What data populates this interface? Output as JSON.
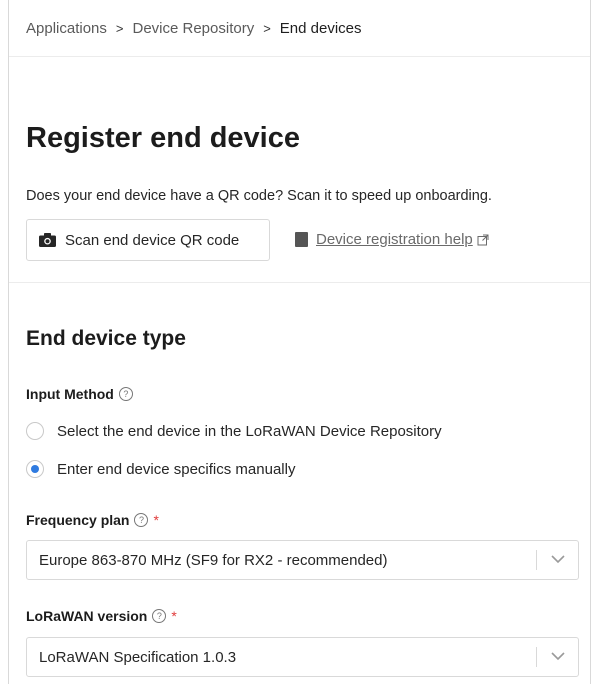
{
  "breadcrumb": {
    "items": [
      "Applications",
      "Device Repository",
      "End devices"
    ],
    "separator": ">"
  },
  "page": {
    "title": "Register end device",
    "subtitle": "Does your end device have a QR code? Scan it to speed up onboarding."
  },
  "actions": {
    "scan_label": "Scan end device QR code",
    "help_label": "Device registration help"
  },
  "section": {
    "title": "End device type"
  },
  "input_method": {
    "label": "Input Method",
    "options": [
      "Select the end device in the LoRaWAN Device Repository",
      "Enter end device specifics manually"
    ],
    "selected_index": 1
  },
  "frequency_plan": {
    "label": "Frequency plan",
    "required_mark": "*",
    "value": "Europe 863-870 MHz (SF9 for RX2 - recommended)"
  },
  "lorawan_version": {
    "label": "LoRaWAN version",
    "required_mark": "*",
    "value": "LoRaWAN Specification 1.0.3"
  },
  "colors": {
    "accent": "#2f7be0",
    "required": "#e03a3a",
    "border": "#d9d9d9"
  }
}
